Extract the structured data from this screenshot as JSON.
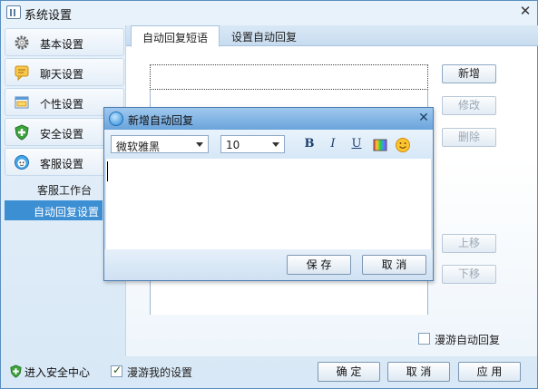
{
  "window": {
    "title": "系统设置",
    "close_glyph": "✕"
  },
  "sidebar": {
    "items": [
      {
        "label": "基本设置",
        "icon": "gear-icon"
      },
      {
        "label": "聊天设置",
        "icon": "chat-icon"
      },
      {
        "label": "个性设置",
        "icon": "personal-icon"
      },
      {
        "label": "安全设置",
        "icon": "shield-icon"
      },
      {
        "label": "客服设置",
        "icon": "service-icon"
      }
    ],
    "sub_items": [
      {
        "label": "客服工作台",
        "active": false
      },
      {
        "label": "自动回复设置",
        "active": true
      }
    ]
  },
  "tabs": [
    {
      "label": "自动回复短语",
      "active": true
    },
    {
      "label": "设置自动回复",
      "active": false
    }
  ],
  "side_buttons": {
    "add": "新增",
    "edit": "修改",
    "delete": "删除",
    "move_up": "上移",
    "move_down": "下移"
  },
  "roam_auto_reply": {
    "label": "漫游自动回复",
    "checked": false
  },
  "bottom": {
    "security_center": "进入安全中心",
    "roam_my_settings": {
      "label": "漫游我的设置",
      "checked": true
    },
    "ok": "确 定",
    "cancel": "取 消",
    "apply": "应 用"
  },
  "dialog": {
    "title": "新增自动回复",
    "close_glyph": "✕",
    "font_family": "微软雅黑",
    "font_size": "10",
    "bold": "B",
    "italic": "I",
    "underline": "U",
    "color_icon": "color-palette-icon",
    "emoji_icon": "smiley-icon",
    "text_value": "",
    "save": "保 存",
    "cancel": "取 消"
  },
  "colors": {
    "accent": "#3d8fd4",
    "border": "#5a8ec0",
    "dialog_title": "#6aa4dc"
  }
}
